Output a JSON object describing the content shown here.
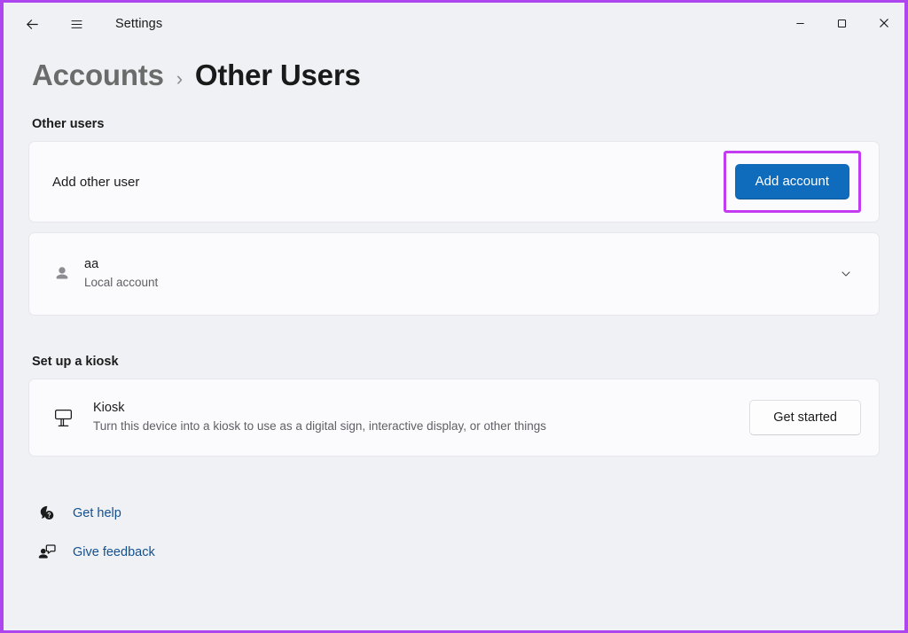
{
  "window": {
    "app_title": "Settings",
    "back_icon": "arrow-left-icon",
    "menu_icon": "hamburger-icon",
    "controls": {
      "minimize": "minimize-icon",
      "maximize": "maximize-icon",
      "close": "close-icon"
    }
  },
  "breadcrumb": {
    "root": "Accounts",
    "separator": "›",
    "current": "Other Users"
  },
  "other_users": {
    "heading": "Other users",
    "add_user": {
      "label": "Add other user",
      "button_label": "Add account",
      "highlighted": true
    },
    "accounts": [
      {
        "name": "aa",
        "type": "Local account",
        "icon": "person-icon",
        "expand_icon": "chevron-down-icon"
      }
    ]
  },
  "kiosk": {
    "heading": "Set up a kiosk",
    "icon": "kiosk-display-icon",
    "title": "Kiosk",
    "description": "Turn this device into a kiosk to use as a digital sign, interactive display, or other things",
    "button_label": "Get started"
  },
  "footer": {
    "links": [
      {
        "label": "Get help",
        "icon": "help-question-bubble-icon"
      },
      {
        "label": "Give feedback",
        "icon": "feedback-person-bubble-icon"
      }
    ]
  },
  "colors": {
    "accent_blue": "#0f6cbd",
    "highlight_purple": "#c23bf0",
    "link_blue": "#12508f",
    "page_background": "#f0f1f5",
    "card_background": "#fbfbfd"
  }
}
